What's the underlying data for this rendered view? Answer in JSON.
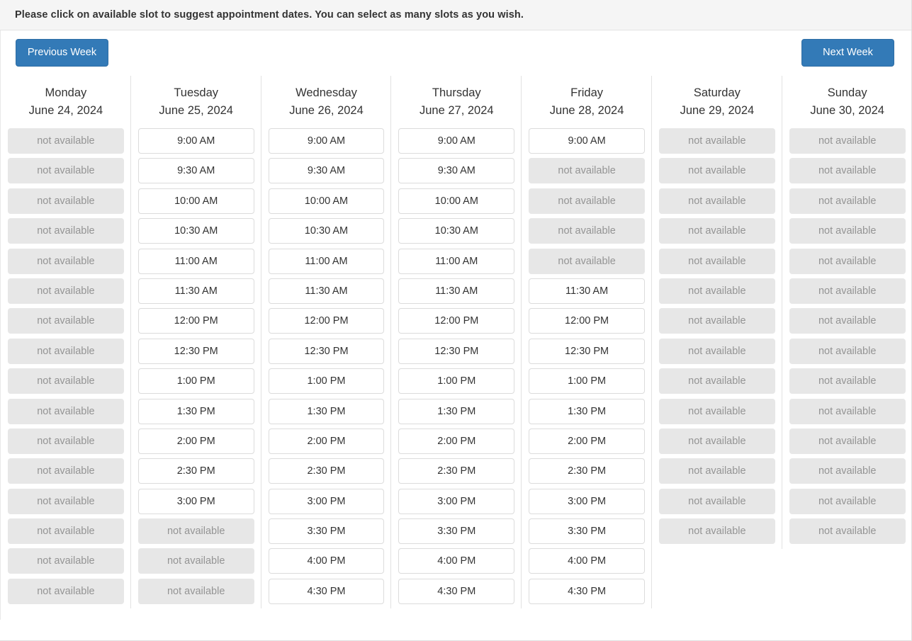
{
  "banner": {
    "instruction": "Please click on available slot to suggest appointment dates. You can select as many slots as you wish."
  },
  "nav": {
    "previous_label": "Previous Week",
    "next_label": "Next Week",
    "button_color": "#337ab7"
  },
  "legend": {
    "unavailable_label": "not available",
    "available_bg": "#ffffff",
    "available_border": "#dcdcdc",
    "unavailable_bg": "#e7e7e7",
    "unavailable_text": "#949494"
  },
  "days": [
    {
      "name": "Monday",
      "date": "June 24, 2024",
      "slots": [
        {
          "label": "not available",
          "available": false
        },
        {
          "label": "not available",
          "available": false
        },
        {
          "label": "not available",
          "available": false
        },
        {
          "label": "not available",
          "available": false
        },
        {
          "label": "not available",
          "available": false
        },
        {
          "label": "not available",
          "available": false
        },
        {
          "label": "not available",
          "available": false
        },
        {
          "label": "not available",
          "available": false
        },
        {
          "label": "not available",
          "available": false
        },
        {
          "label": "not available",
          "available": false
        },
        {
          "label": "not available",
          "available": false
        },
        {
          "label": "not available",
          "available": false
        },
        {
          "label": "not available",
          "available": false
        },
        {
          "label": "not available",
          "available": false
        },
        {
          "label": "not available",
          "available": false
        },
        {
          "label": "not available",
          "available": false
        }
      ]
    },
    {
      "name": "Tuesday",
      "date": "June 25, 2024",
      "slots": [
        {
          "label": "9:00 AM",
          "available": true
        },
        {
          "label": "9:30 AM",
          "available": true
        },
        {
          "label": "10:00 AM",
          "available": true
        },
        {
          "label": "10:30 AM",
          "available": true
        },
        {
          "label": "11:00 AM",
          "available": true
        },
        {
          "label": "11:30 AM",
          "available": true
        },
        {
          "label": "12:00 PM",
          "available": true
        },
        {
          "label": "12:30 PM",
          "available": true
        },
        {
          "label": "1:00 PM",
          "available": true
        },
        {
          "label": "1:30 PM",
          "available": true
        },
        {
          "label": "2:00 PM",
          "available": true
        },
        {
          "label": "2:30 PM",
          "available": true
        },
        {
          "label": "3:00 PM",
          "available": true
        },
        {
          "label": "not available",
          "available": false
        },
        {
          "label": "not available",
          "available": false
        },
        {
          "label": "not available",
          "available": false
        }
      ]
    },
    {
      "name": "Wednesday",
      "date": "June 26, 2024",
      "slots": [
        {
          "label": "9:00 AM",
          "available": true
        },
        {
          "label": "9:30 AM",
          "available": true
        },
        {
          "label": "10:00 AM",
          "available": true
        },
        {
          "label": "10:30 AM",
          "available": true
        },
        {
          "label": "11:00 AM",
          "available": true
        },
        {
          "label": "11:30 AM",
          "available": true
        },
        {
          "label": "12:00 PM",
          "available": true
        },
        {
          "label": "12:30 PM",
          "available": true
        },
        {
          "label": "1:00 PM",
          "available": true
        },
        {
          "label": "1:30 PM",
          "available": true
        },
        {
          "label": "2:00 PM",
          "available": true
        },
        {
          "label": "2:30 PM",
          "available": true
        },
        {
          "label": "3:00 PM",
          "available": true
        },
        {
          "label": "3:30 PM",
          "available": true
        },
        {
          "label": "4:00 PM",
          "available": true
        },
        {
          "label": "4:30 PM",
          "available": true
        }
      ]
    },
    {
      "name": "Thursday",
      "date": "June 27, 2024",
      "slots": [
        {
          "label": "9:00 AM",
          "available": true
        },
        {
          "label": "9:30 AM",
          "available": true
        },
        {
          "label": "10:00 AM",
          "available": true
        },
        {
          "label": "10:30 AM",
          "available": true
        },
        {
          "label": "11:00 AM",
          "available": true
        },
        {
          "label": "11:30 AM",
          "available": true
        },
        {
          "label": "12:00 PM",
          "available": true
        },
        {
          "label": "12:30 PM",
          "available": true
        },
        {
          "label": "1:00 PM",
          "available": true
        },
        {
          "label": "1:30 PM",
          "available": true
        },
        {
          "label": "2:00 PM",
          "available": true
        },
        {
          "label": "2:30 PM",
          "available": true
        },
        {
          "label": "3:00 PM",
          "available": true
        },
        {
          "label": "3:30 PM",
          "available": true
        },
        {
          "label": "4:00 PM",
          "available": true
        },
        {
          "label": "4:30 PM",
          "available": true
        }
      ]
    },
    {
      "name": "Friday",
      "date": "June 28, 2024",
      "slots": [
        {
          "label": "9:00 AM",
          "available": true
        },
        {
          "label": "not available",
          "available": false
        },
        {
          "label": "not available",
          "available": false
        },
        {
          "label": "not available",
          "available": false
        },
        {
          "label": "not available",
          "available": false
        },
        {
          "label": "11:30 AM",
          "available": true
        },
        {
          "label": "12:00 PM",
          "available": true
        },
        {
          "label": "12:30 PM",
          "available": true
        },
        {
          "label": "1:00 PM",
          "available": true
        },
        {
          "label": "1:30 PM",
          "available": true
        },
        {
          "label": "2:00 PM",
          "available": true
        },
        {
          "label": "2:30 PM",
          "available": true
        },
        {
          "label": "3:00 PM",
          "available": true
        },
        {
          "label": "3:30 PM",
          "available": true
        },
        {
          "label": "4:00 PM",
          "available": true
        },
        {
          "label": "4:30 PM",
          "available": true
        }
      ]
    },
    {
      "name": "Saturday",
      "date": "June 29, 2024",
      "slots": [
        {
          "label": "not available",
          "available": false
        },
        {
          "label": "not available",
          "available": false
        },
        {
          "label": "not available",
          "available": false
        },
        {
          "label": "not available",
          "available": false
        },
        {
          "label": "not available",
          "available": false
        },
        {
          "label": "not available",
          "available": false
        },
        {
          "label": "not available",
          "available": false
        },
        {
          "label": "not available",
          "available": false
        },
        {
          "label": "not available",
          "available": false
        },
        {
          "label": "not available",
          "available": false
        },
        {
          "label": "not available",
          "available": false
        },
        {
          "label": "not available",
          "available": false
        },
        {
          "label": "not available",
          "available": false
        },
        {
          "label": "not available",
          "available": false
        }
      ]
    },
    {
      "name": "Sunday",
      "date": "June 30, 2024",
      "slots": [
        {
          "label": "not available",
          "available": false
        },
        {
          "label": "not available",
          "available": false
        },
        {
          "label": "not available",
          "available": false
        },
        {
          "label": "not available",
          "available": false
        },
        {
          "label": "not available",
          "available": false
        },
        {
          "label": "not available",
          "available": false
        },
        {
          "label": "not available",
          "available": false
        },
        {
          "label": "not available",
          "available": false
        },
        {
          "label": "not available",
          "available": false
        },
        {
          "label": "not available",
          "available": false
        },
        {
          "label": "not available",
          "available": false
        },
        {
          "label": "not available",
          "available": false
        },
        {
          "label": "not available",
          "available": false
        },
        {
          "label": "not available",
          "available": false
        }
      ]
    }
  ]
}
